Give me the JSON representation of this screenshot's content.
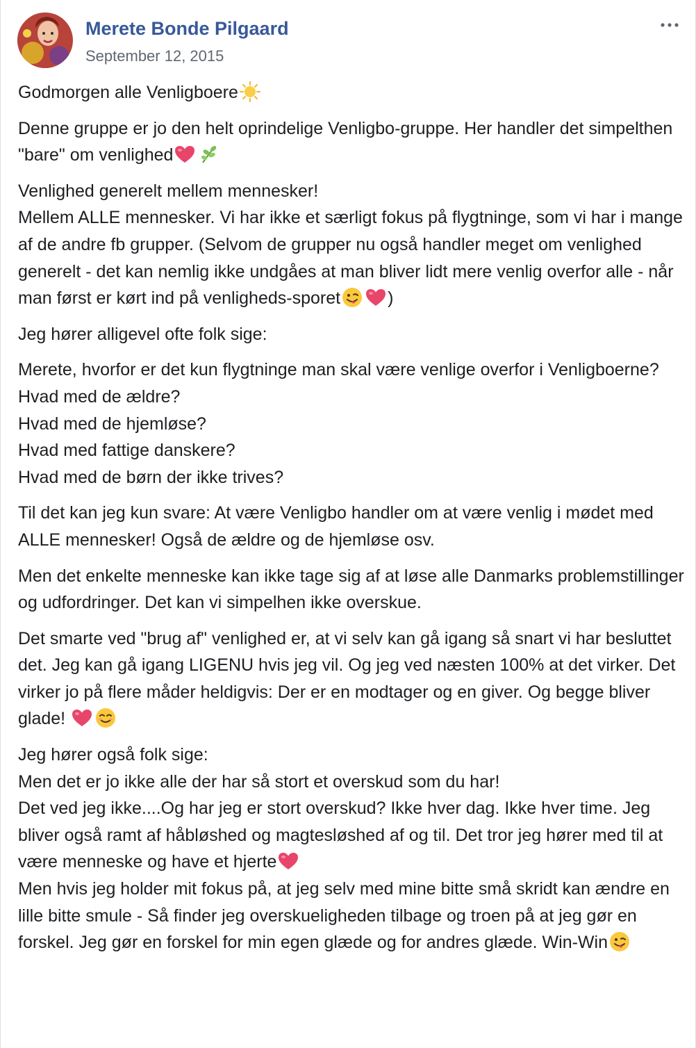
{
  "post": {
    "author": "Merete Bonde Pilgaard",
    "timestamp": "September 12, 2015",
    "paragraphs": [
      [
        "Godmorgen alle Venligboere",
        "sun-emoji"
      ],
      [
        "Denne gruppe er jo den helt oprindelige Venligbo-gruppe. Her handler det simpelthen \"bare\" om venlighed",
        "heart-emoji",
        "herb-emoji"
      ],
      [
        "Venlighed generelt mellem mennesker!\nMellem ALLE mennesker. Vi har ikke et særligt fokus på flygtninge, som vi har i mange af de andre fb grupper. (Selvom de grupper nu også handler meget om venlighed generelt - det kan nemlig ikke undgåes at man bliver lidt mere venlig overfor alle - når man først er kørt ind på venligheds-sporet",
        "wink-tongue-emoji",
        "heart-emoji",
        ")"
      ],
      [
        "Jeg hører alligevel ofte folk sige:"
      ],
      [
        "Merete, hvorfor er det kun flygtninge man skal være venlige overfor i Venligboerne?\nHvad med de ældre?\nHvad med de hjemløse?\nHvad med fattige danskere?\nHvad med de børn der ikke trives?"
      ],
      [
        "Til det kan jeg kun svare: At være Venligbo handler om at være venlig i mødet med ALLE mennesker! Også de ældre og de hjemløse osv."
      ],
      [
        "Men det enkelte menneske kan ikke tage sig af at løse alle Danmarks problemstillinger og udfordringer. Det kan vi simpelhen ikke overskue."
      ],
      [
        "Det smarte ved \"brug af\" venlighed er, at vi selv kan gå igang så snart vi har besluttet det. Jeg kan gå igang LIGENU hvis jeg vil. Og jeg ved næsten 100% at det virker. Det virker jo på flere måder heldigvis: Der er en modtager og en giver. Og begge bliver glade! ",
        "heart-emoji",
        "smile-emoji"
      ],
      [
        "Jeg hører også folk sige:\nMen det er jo ikke alle der har så stort et overskud som du har!\nDet ved jeg ikke....Og har jeg er stort overskud? Ikke hver dag. Ikke hver time. Jeg bliver også ramt af håbløshed og magtesløshed af og til. Det tror jeg hører med til at være menneske og have et hjerte",
        "heart-emoji",
        "\nMen hvis jeg holder mit fokus på, at jeg selv med mine bitte små skridt kan ændre en lille bitte smule - Så finder jeg overskueligheden tilbage og troen på at jeg gør en forskel. Jeg gør en forskel for min egen glæde og for andres glæde. Win-Win",
        "wink-tongue-emoji"
      ]
    ]
  },
  "icons": {
    "more": "more-horizontal-icon"
  },
  "colors": {
    "author_link": "#385898",
    "timestamp": "#606770",
    "body_text": "#1c1e21",
    "heart": "#e8456a"
  }
}
